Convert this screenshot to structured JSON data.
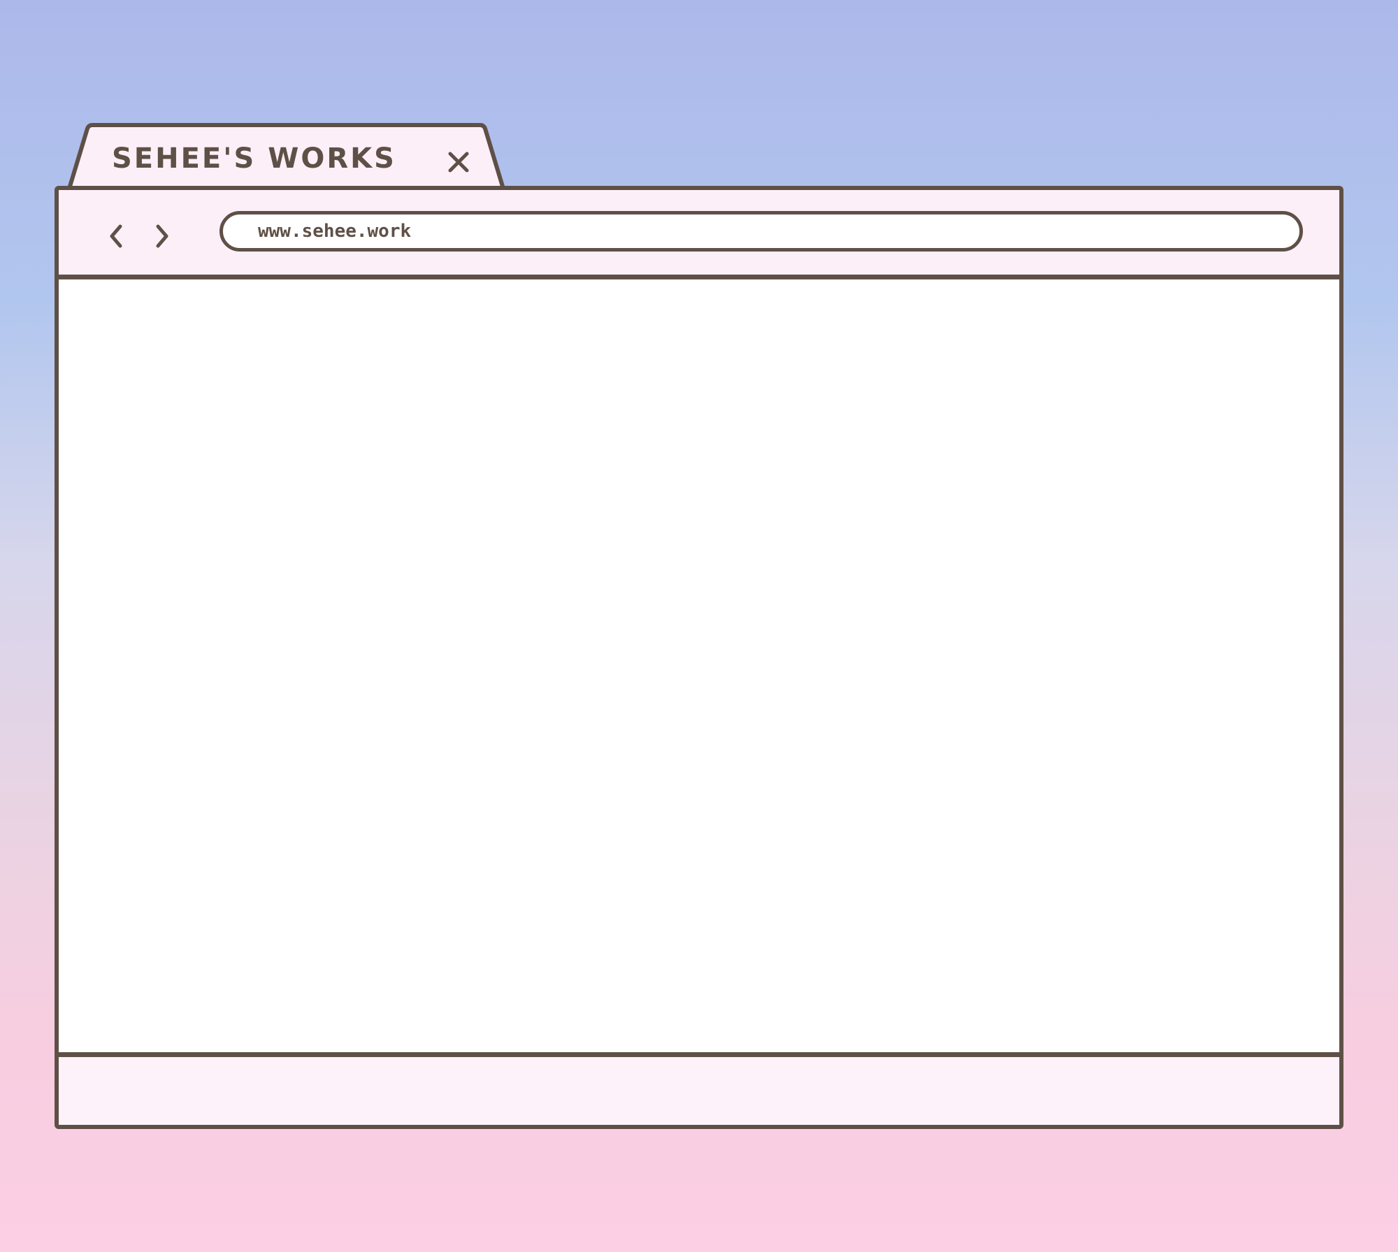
{
  "tab": {
    "title": "SEHEE'S WORKS",
    "close_icon": "close-icon"
  },
  "toolbar": {
    "back_icon": "chevron-left-icon",
    "forward_icon": "chevron-right-icon",
    "address": "www.sehee.work"
  },
  "colors": {
    "outline": "#5f5047",
    "chrome_fill": "#fdeff8",
    "content": "#ffffff",
    "background_top": "#adb8ea",
    "background_bottom": "#fccfe4"
  }
}
